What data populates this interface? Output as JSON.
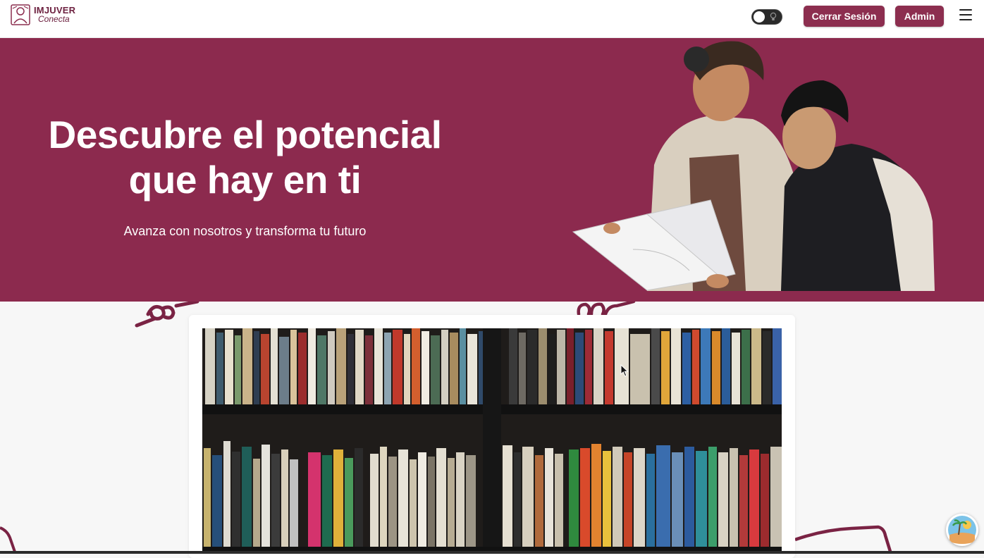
{
  "navbar": {
    "logo_name": "IMJUVER",
    "logo_sub": "Conecta",
    "theme_toggle_icon": "lightbulb-icon",
    "logout_label": "Cerrar Sesión",
    "admin_label": "Admin",
    "menu_icon": "hamburger-menu-icon"
  },
  "hero": {
    "title": "Descubre el potencial que hay en ti",
    "subtitle": "Avanza con nosotros y transforma tu futuro",
    "background_color": "#8c2a4e"
  },
  "content": {
    "image": "bookshelf-photo"
  },
  "colors": {
    "brand": "#8c2e4f",
    "hero": "#8c2a4e",
    "background": "#f7f7f7"
  }
}
